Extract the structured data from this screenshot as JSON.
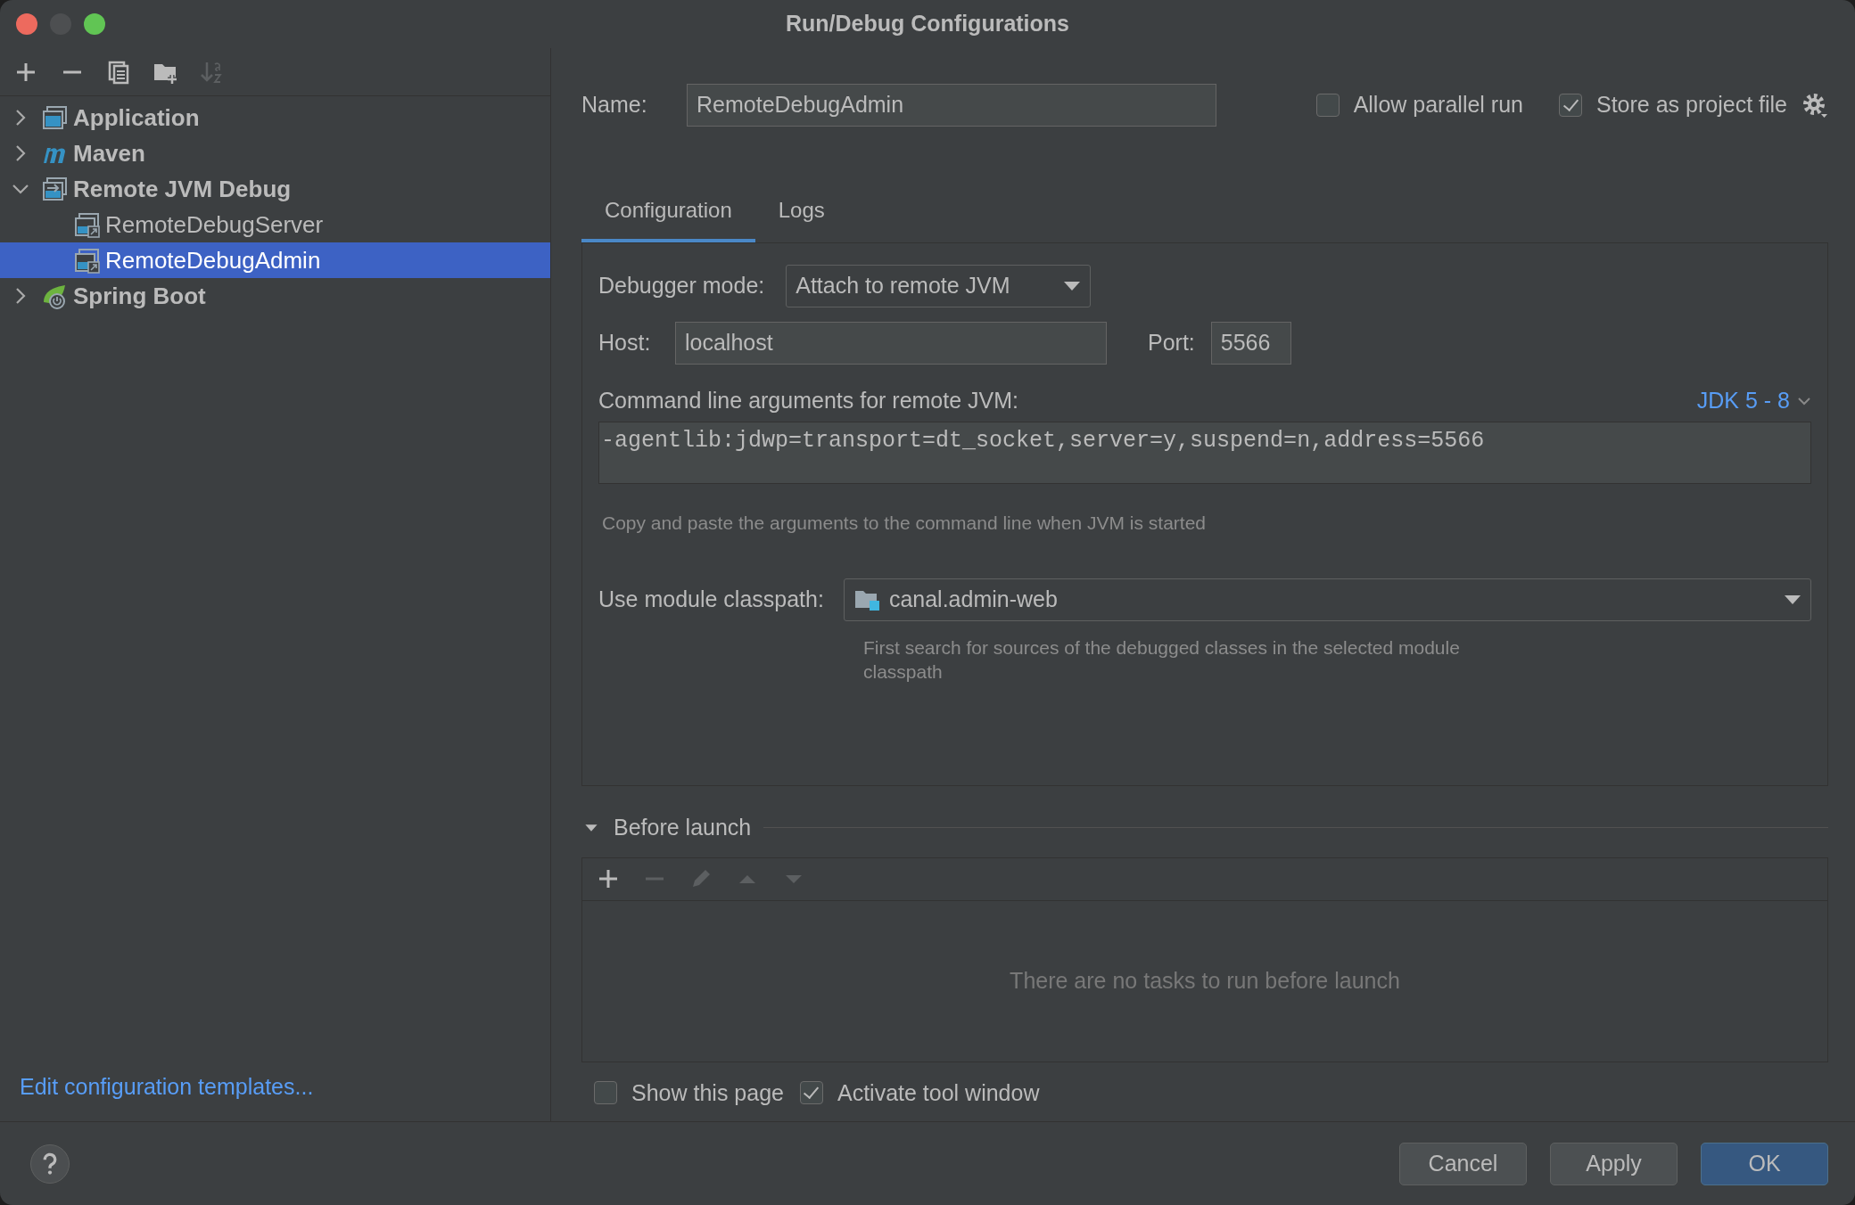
{
  "window": {
    "title": "Run/Debug Configurations"
  },
  "tree_toolbar": [
    {
      "kind": "add",
      "disabled": false
    },
    {
      "kind": "remove",
      "disabled": false
    },
    {
      "kind": "copy",
      "disabled": false
    },
    {
      "kind": "folder",
      "disabled": false
    },
    {
      "kind": "sort",
      "disabled": true
    }
  ],
  "tree": [
    {
      "label": "Application",
      "kind": "application",
      "expanded": false,
      "selected": false
    },
    {
      "label": "Maven",
      "kind": "maven",
      "expanded": false,
      "selected": false
    },
    {
      "label": "Remote JVM Debug",
      "kind": "remote",
      "expanded": true,
      "selected": false,
      "children": [
        {
          "label": "RemoteDebugServer",
          "kind": "config",
          "selected": false
        },
        {
          "label": "RemoteDebugAdmin",
          "kind": "config",
          "selected": true
        }
      ]
    },
    {
      "label": "Spring Boot",
      "kind": "spring",
      "expanded": false,
      "selected": false
    }
  ],
  "templates_link": "Edit configuration templates...",
  "name": {
    "label": "Name:",
    "value": "RemoteDebugAdmin"
  },
  "options": [
    {
      "label": "Allow parallel run",
      "checked": false
    },
    {
      "label": "Store as project file",
      "checked": true
    }
  ],
  "tabs": [
    {
      "label": "Configuration",
      "selected": true
    },
    {
      "label": "Logs",
      "selected": false
    }
  ],
  "debugger_mode": {
    "label": "Debugger mode:",
    "value": "Attach to remote JVM"
  },
  "host": {
    "label": "Host:",
    "value": "localhost"
  },
  "port": {
    "label": "Port:",
    "value": "5566"
  },
  "command_line": {
    "label": "Command line arguments for remote JVM:",
    "jdk": "JDK 5 - 8",
    "value": "-agentlib:jdwp=transport=dt_socket,server=y,suspend=n,address=5566",
    "hint": "Copy and paste the arguments to the command line when JVM is started"
  },
  "module_classpath": {
    "label": "Use module classpath:",
    "value": "canal.admin-web",
    "hint": "First search for sources of the debugged classes in the selected module classpath"
  },
  "before_launch": {
    "title": "Before launch",
    "expanded": true,
    "toolbar": [
      {
        "kind": "add",
        "disabled": false
      },
      {
        "kind": "remove",
        "disabled": true
      },
      {
        "kind": "edit",
        "disabled": true
      },
      {
        "kind": "up",
        "disabled": true
      },
      {
        "kind": "down",
        "disabled": true
      }
    ],
    "empty_text": "There are no tasks to run before launch"
  },
  "launch_options": [
    {
      "label": "Show this page",
      "checked": false
    },
    {
      "label": "Activate tool window",
      "checked": true
    }
  ],
  "buttons": [
    {
      "label": "Cancel",
      "kind": "default"
    },
    {
      "label": "Apply",
      "kind": "default"
    },
    {
      "label": "OK",
      "kind": "primary"
    }
  ]
}
